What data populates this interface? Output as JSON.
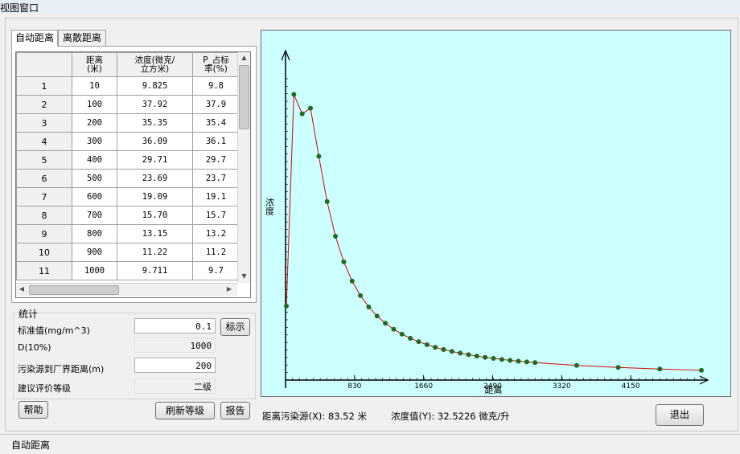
{
  "window": {
    "title": "视图窗口"
  },
  "tabs": [
    {
      "label": "自动距离",
      "active": true
    },
    {
      "label": "离散距离",
      "active": false
    }
  ],
  "table": {
    "headers": [
      "",
      "距离\n(米)",
      "浓度(微克/\n立方米)",
      "P_占标\n率(%)"
    ],
    "rows": [
      [
        "1",
        "10",
        "9.825",
        "9.8"
      ],
      [
        "2",
        "100",
        "37.92",
        "37.9"
      ],
      [
        "3",
        "200",
        "35.35",
        "35.4"
      ],
      [
        "4",
        "300",
        "36.09",
        "36.1"
      ],
      [
        "5",
        "400",
        "29.71",
        "29.7"
      ],
      [
        "6",
        "500",
        "23.69",
        "23.7"
      ],
      [
        "7",
        "600",
        "19.09",
        "19.1"
      ],
      [
        "8",
        "700",
        "15.70",
        "15.7"
      ],
      [
        "9",
        "800",
        "13.15",
        "13.2"
      ],
      [
        "10",
        "900",
        "11.22",
        "11.2"
      ],
      [
        "11",
        "1000",
        "9.711",
        "9.7"
      ]
    ]
  },
  "stats": {
    "group_title": "统计",
    "standard_label": "标准值(mg/m^3)",
    "standard_value": "0.1",
    "show_button": "标示",
    "d10_label": "D(10%)",
    "d10_value": "1000",
    "distance_label": "污染源到厂界距离(m)",
    "distance_value": "200",
    "grade_label": "建议评价等级",
    "grade_value": "二级"
  },
  "buttons": {
    "help": "帮助",
    "refresh": "刷新等级",
    "report": "报告",
    "exit": "退出"
  },
  "readout": {
    "distance": "距离污染源(X): 83.52 米",
    "concentration": "浓度值(Y): 32.5226 微克/升"
  },
  "status": {
    "text": "自动距离"
  },
  "colors": {
    "plot_background": "#ccffff",
    "line": "#dd0000",
    "marker": "#1f6b1f"
  },
  "chart_data": {
    "type": "line",
    "xlabel": "距离",
    "ylabel": "浓度",
    "xticks": [
      "830",
      "1660",
      "2490",
      "3320",
      "4150"
    ],
    "xlim": [
      0,
      5000
    ],
    "ylim": [
      0,
      40
    ],
    "x": [
      10,
      100,
      200,
      300,
      400,
      500,
      600,
      700,
      800,
      900,
      1000,
      1100,
      1200,
      1300,
      1400,
      1500,
      1600,
      1700,
      1800,
      1900,
      2000,
      2100,
      2200,
      2300,
      2400,
      2500,
      2600,
      2700,
      2800,
      2900,
      3000,
      3500,
      4000,
      4500,
      5000
    ],
    "series": [
      {
        "values": [
          9.825,
          37.92,
          35.35,
          36.09,
          29.71,
          23.69,
          19.09,
          15.7,
          13.15,
          11.22,
          9.711,
          8.5,
          7.55,
          6.75,
          6.1,
          5.55,
          5.1,
          4.7,
          4.35,
          4.05,
          3.8,
          3.57,
          3.37,
          3.18,
          3.02,
          2.88,
          2.74,
          2.62,
          2.51,
          2.41,
          2.32,
          1.95,
          1.68,
          1.47,
          1.3
        ]
      }
    ]
  }
}
